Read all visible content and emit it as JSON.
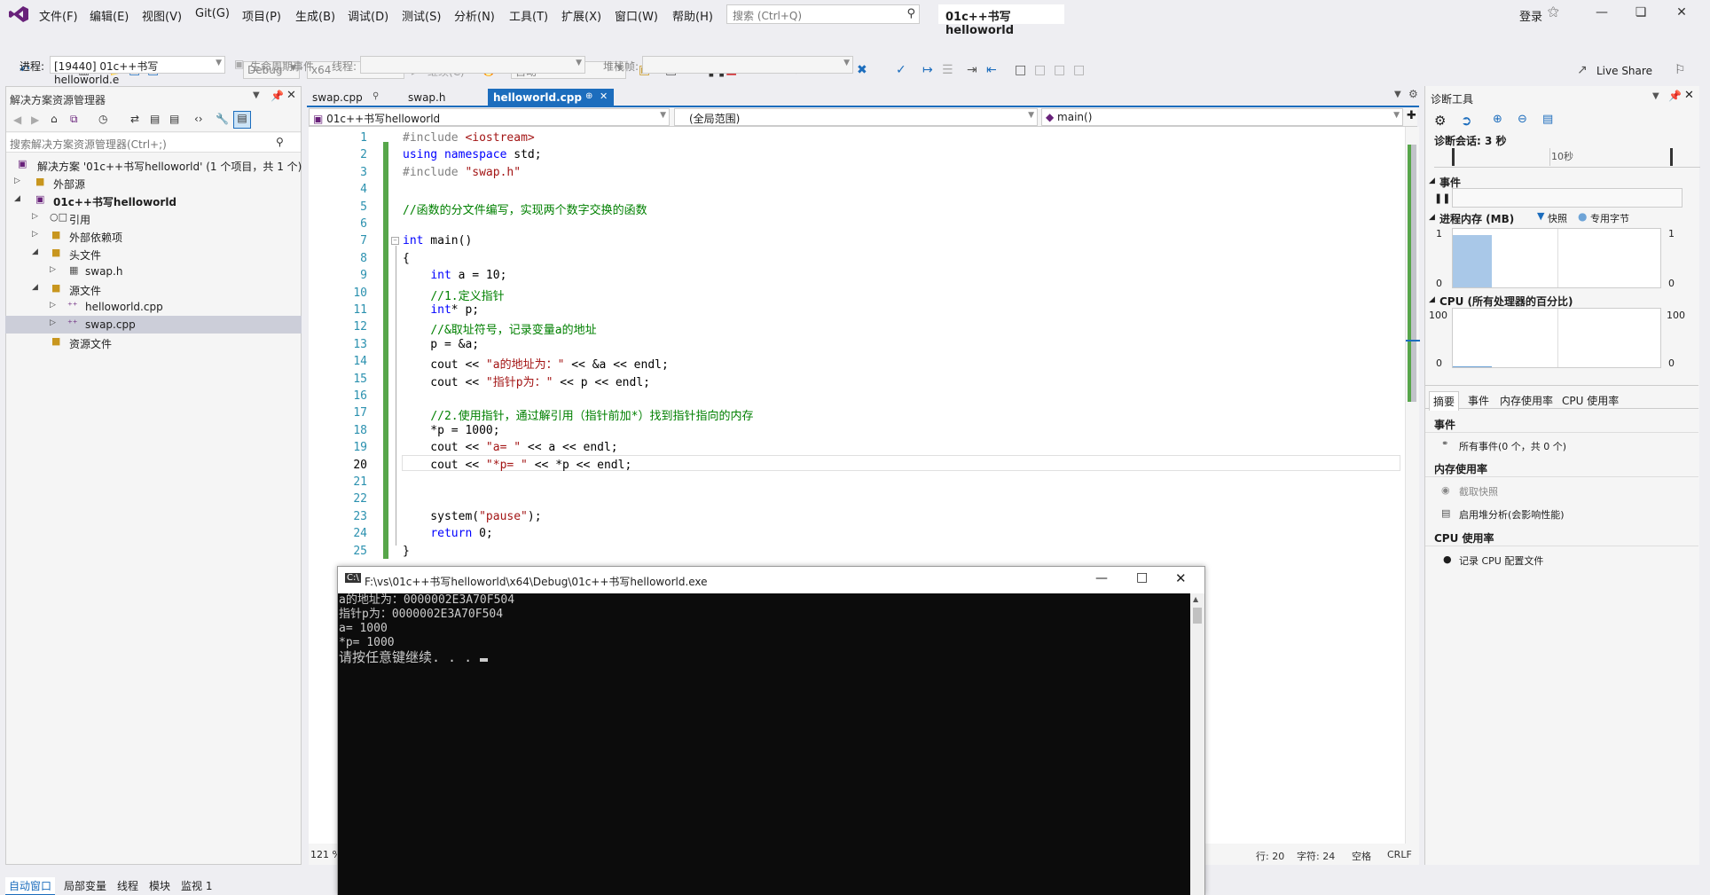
{
  "menu": [
    "文件(F)",
    "编辑(E)",
    "视图(V)",
    "Git(G)",
    "项目(P)",
    "生成(B)",
    "调试(D)",
    "测试(S)",
    "分析(N)",
    "工具(T)",
    "扩展(X)",
    "窗口(W)",
    "帮助(H)"
  ],
  "search": {
    "placeholder": "搜索 (Ctrl+Q)"
  },
  "project_title": "01c++书写helloworld",
  "login": "登录",
  "live_share": "Live Share",
  "toolbar": {
    "config": "Debug",
    "platform": "x64",
    "continue": "继续(C)",
    "auto": "自动"
  },
  "process_bar": {
    "process_label": "进程:",
    "process_value": "[19440] 01c++书写helloworld.e",
    "lifecycle": "生命周期事件",
    "thread_label": "线程:",
    "stack_label": "堆栈帧:"
  },
  "solution_explorer": {
    "title": "解决方案资源管理器",
    "search": "搜索解决方案资源管理器(Ctrl+;)",
    "items": [
      {
        "label": "解决方案 '01c++书写helloworld' (1 个项目，共 1 个)"
      },
      {
        "label": "外部源"
      },
      {
        "label": "01c++书写helloworld"
      },
      {
        "label": "引用"
      },
      {
        "label": "外部依赖项"
      },
      {
        "label": "头文件"
      },
      {
        "label": "swap.h"
      },
      {
        "label": "源文件"
      },
      {
        "label": "helloworld.cpp"
      },
      {
        "label": "swap.cpp"
      },
      {
        "label": "资源文件"
      }
    ]
  },
  "tabs": [
    "swap.cpp",
    "swap.h",
    "helloworld.cpp"
  ],
  "navbar": {
    "project": "01c++书写helloworld",
    "scope": "(全局范围)",
    "member": "main()"
  },
  "code": {
    "line_numbers": [
      "1",
      "2",
      "3",
      "4",
      "5",
      "6",
      "7",
      "8",
      "9",
      "10",
      "11",
      "12",
      "13",
      "14",
      "15",
      "16",
      "17",
      "18",
      "19",
      "20",
      "21",
      "22",
      "23",
      "24",
      "25"
    ],
    "lines": [
      "#include <iostream>",
      "using namespace std;",
      "#include \"swap.h\"",
      "",
      "//函数的分文件编写，实现两个数字交换的函数",
      "",
      "int main()",
      "{",
      "    int a = 10;",
      "    //1.定义指针",
      "    int* p;",
      "    //&取址符号，记录变量a的地址",
      "    p = &a;",
      "    cout << \"a的地址为：\" << &a << endl;",
      "    cout << \"指针p为：\" << p << endl;",
      "",
      "    //2.使用指针，通过解引用（指针前加*）找到指针指向的内存",
      "    *p = 1000;",
      "    cout << \"a= \" << a << endl;",
      "    cout << \"*p= \" << *p << endl;",
      "",
      "",
      "    system(\"pause\");",
      "    return 0;",
      "}"
    ]
  },
  "zoom": "121 %",
  "status": {
    "line": "行: 20",
    "col": "字符: 24",
    "ws": "空格",
    "eol": "CRLF"
  },
  "console": {
    "title": "F:\\vs\\01c++书写helloworld\\x64\\Debug\\01c++书写helloworld.exe",
    "output": [
      "a的地址为：0000002E3A70F504",
      "指针p为：0000002E3A70F504",
      "a= 1000",
      "*p= 1000",
      "请按任意键继续. . . "
    ]
  },
  "diag": {
    "title": "诊断工具",
    "session": "诊断会话: 3 秒",
    "timeline_tick": "10秒",
    "events": "事件",
    "memory": "进程内存 (MB)",
    "snapshot": "快照",
    "private_bytes": "专用字节",
    "mem_max": "1",
    "mem_min": "0",
    "cpu": "CPU (所有处理器的百分比)",
    "cpu_max": "100",
    "cpu_min": "0",
    "tabs": [
      "摘要",
      "事件",
      "内存使用率",
      "CPU 使用率"
    ],
    "sec_events": "事件",
    "all_events": "所有事件(0 个，共 0 个)",
    "sec_memory": "内存使用率",
    "take_snapshot": "截取快照",
    "heap_profiling": "启用堆分析(会影响性能)",
    "sec_cpu": "CPU 使用率",
    "record_cpu": "记录 CPU 配置文件",
    "memory_value": 0.9
  },
  "bottom_tabs": [
    "自动窗口",
    "局部变量",
    "线程",
    "模块",
    "监视 1"
  ]
}
